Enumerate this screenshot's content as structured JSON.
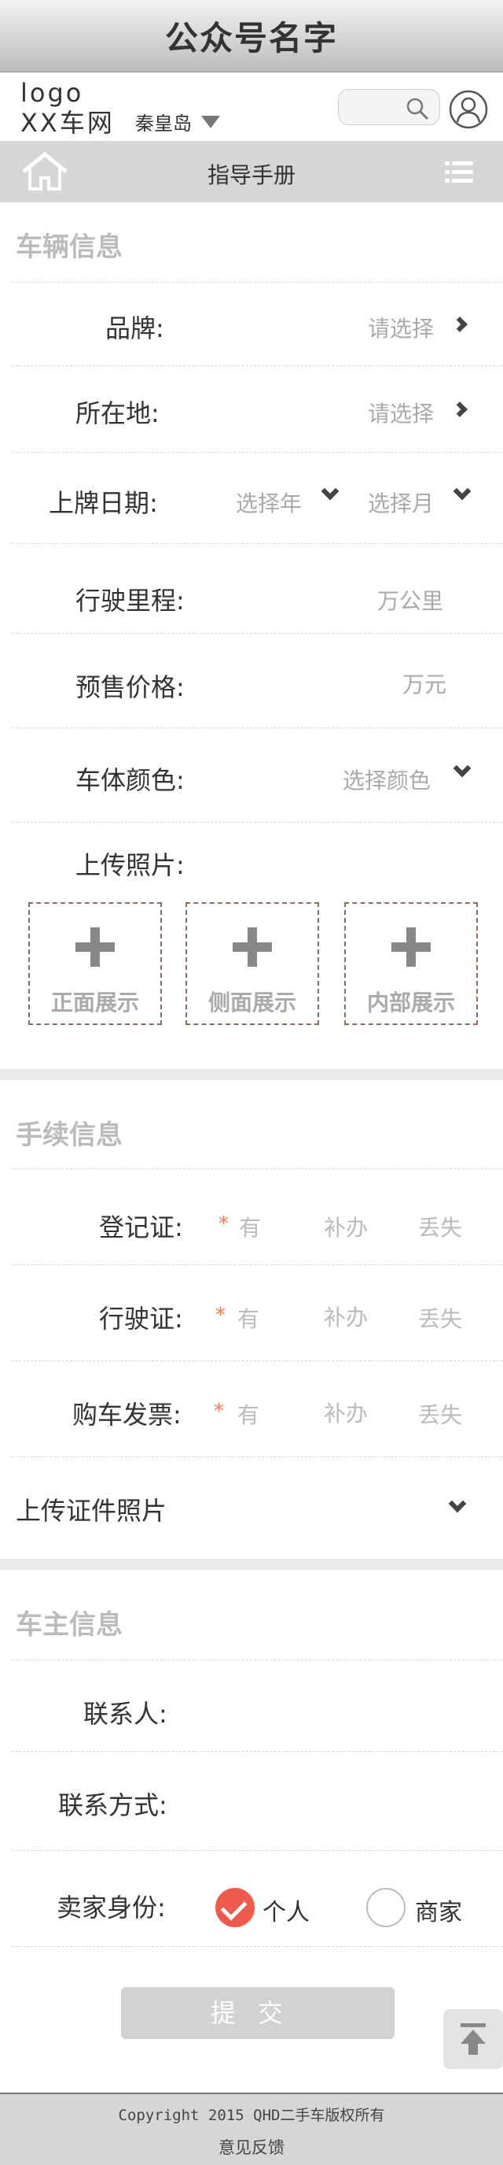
{
  "app_title": "公众号名字",
  "header": {
    "logo_line1": "logo",
    "logo_line2": "XX车网",
    "city": "秦皇岛"
  },
  "navbar": {
    "title": "指导手册"
  },
  "vehicle": {
    "section_title": "车辆信息",
    "brand_label": "品牌:",
    "brand_hint": "请选择",
    "location_label": "所在地:",
    "location_hint": "请选择",
    "reg_date_label": "上牌日期:",
    "reg_year_hint": "选择年",
    "reg_month_hint": "选择月",
    "mileage_label": "行驶里程:",
    "mileage_unit": "万公里",
    "price_label": "预售价格:",
    "price_unit": "万元",
    "color_label": "车体颜色:",
    "color_hint": "选择颜色",
    "photos_label": "上传照片:",
    "photo_front": "正面展示",
    "photo_side": "侧面展示",
    "photo_interior": "内部展示"
  },
  "procedures": {
    "section_title": "手续信息",
    "rows": [
      {
        "label": "登记证:",
        "star": "*",
        "opt1": "有",
        "opt2": "补办",
        "opt3": "丢失"
      },
      {
        "label": "行驶证:",
        "star": "*",
        "opt1": "有",
        "opt2": "补办",
        "opt3": "丢失"
      },
      {
        "label": "购车发票:",
        "star": "*",
        "opt1": "有",
        "opt2": "补办",
        "opt3": "丢失"
      }
    ],
    "upload_docs_label": "上传证件照片"
  },
  "owner": {
    "section_title": "车主信息",
    "contact_label": "联系人:",
    "phone_label": "联系方式:",
    "identity_label": "卖家身份:",
    "identity_personal": "个人",
    "identity_dealer": "商家",
    "identity_selected": "个人"
  },
  "submit_label": "提交",
  "footer": {
    "copyright": "Copyright  2015 QHD二手车版权所有",
    "feedback": "意见反馈"
  },
  "colors": {
    "accent_radio": "#f05a4a",
    "required_star": "#f07a4c",
    "upload_border": "#8b6d62"
  }
}
